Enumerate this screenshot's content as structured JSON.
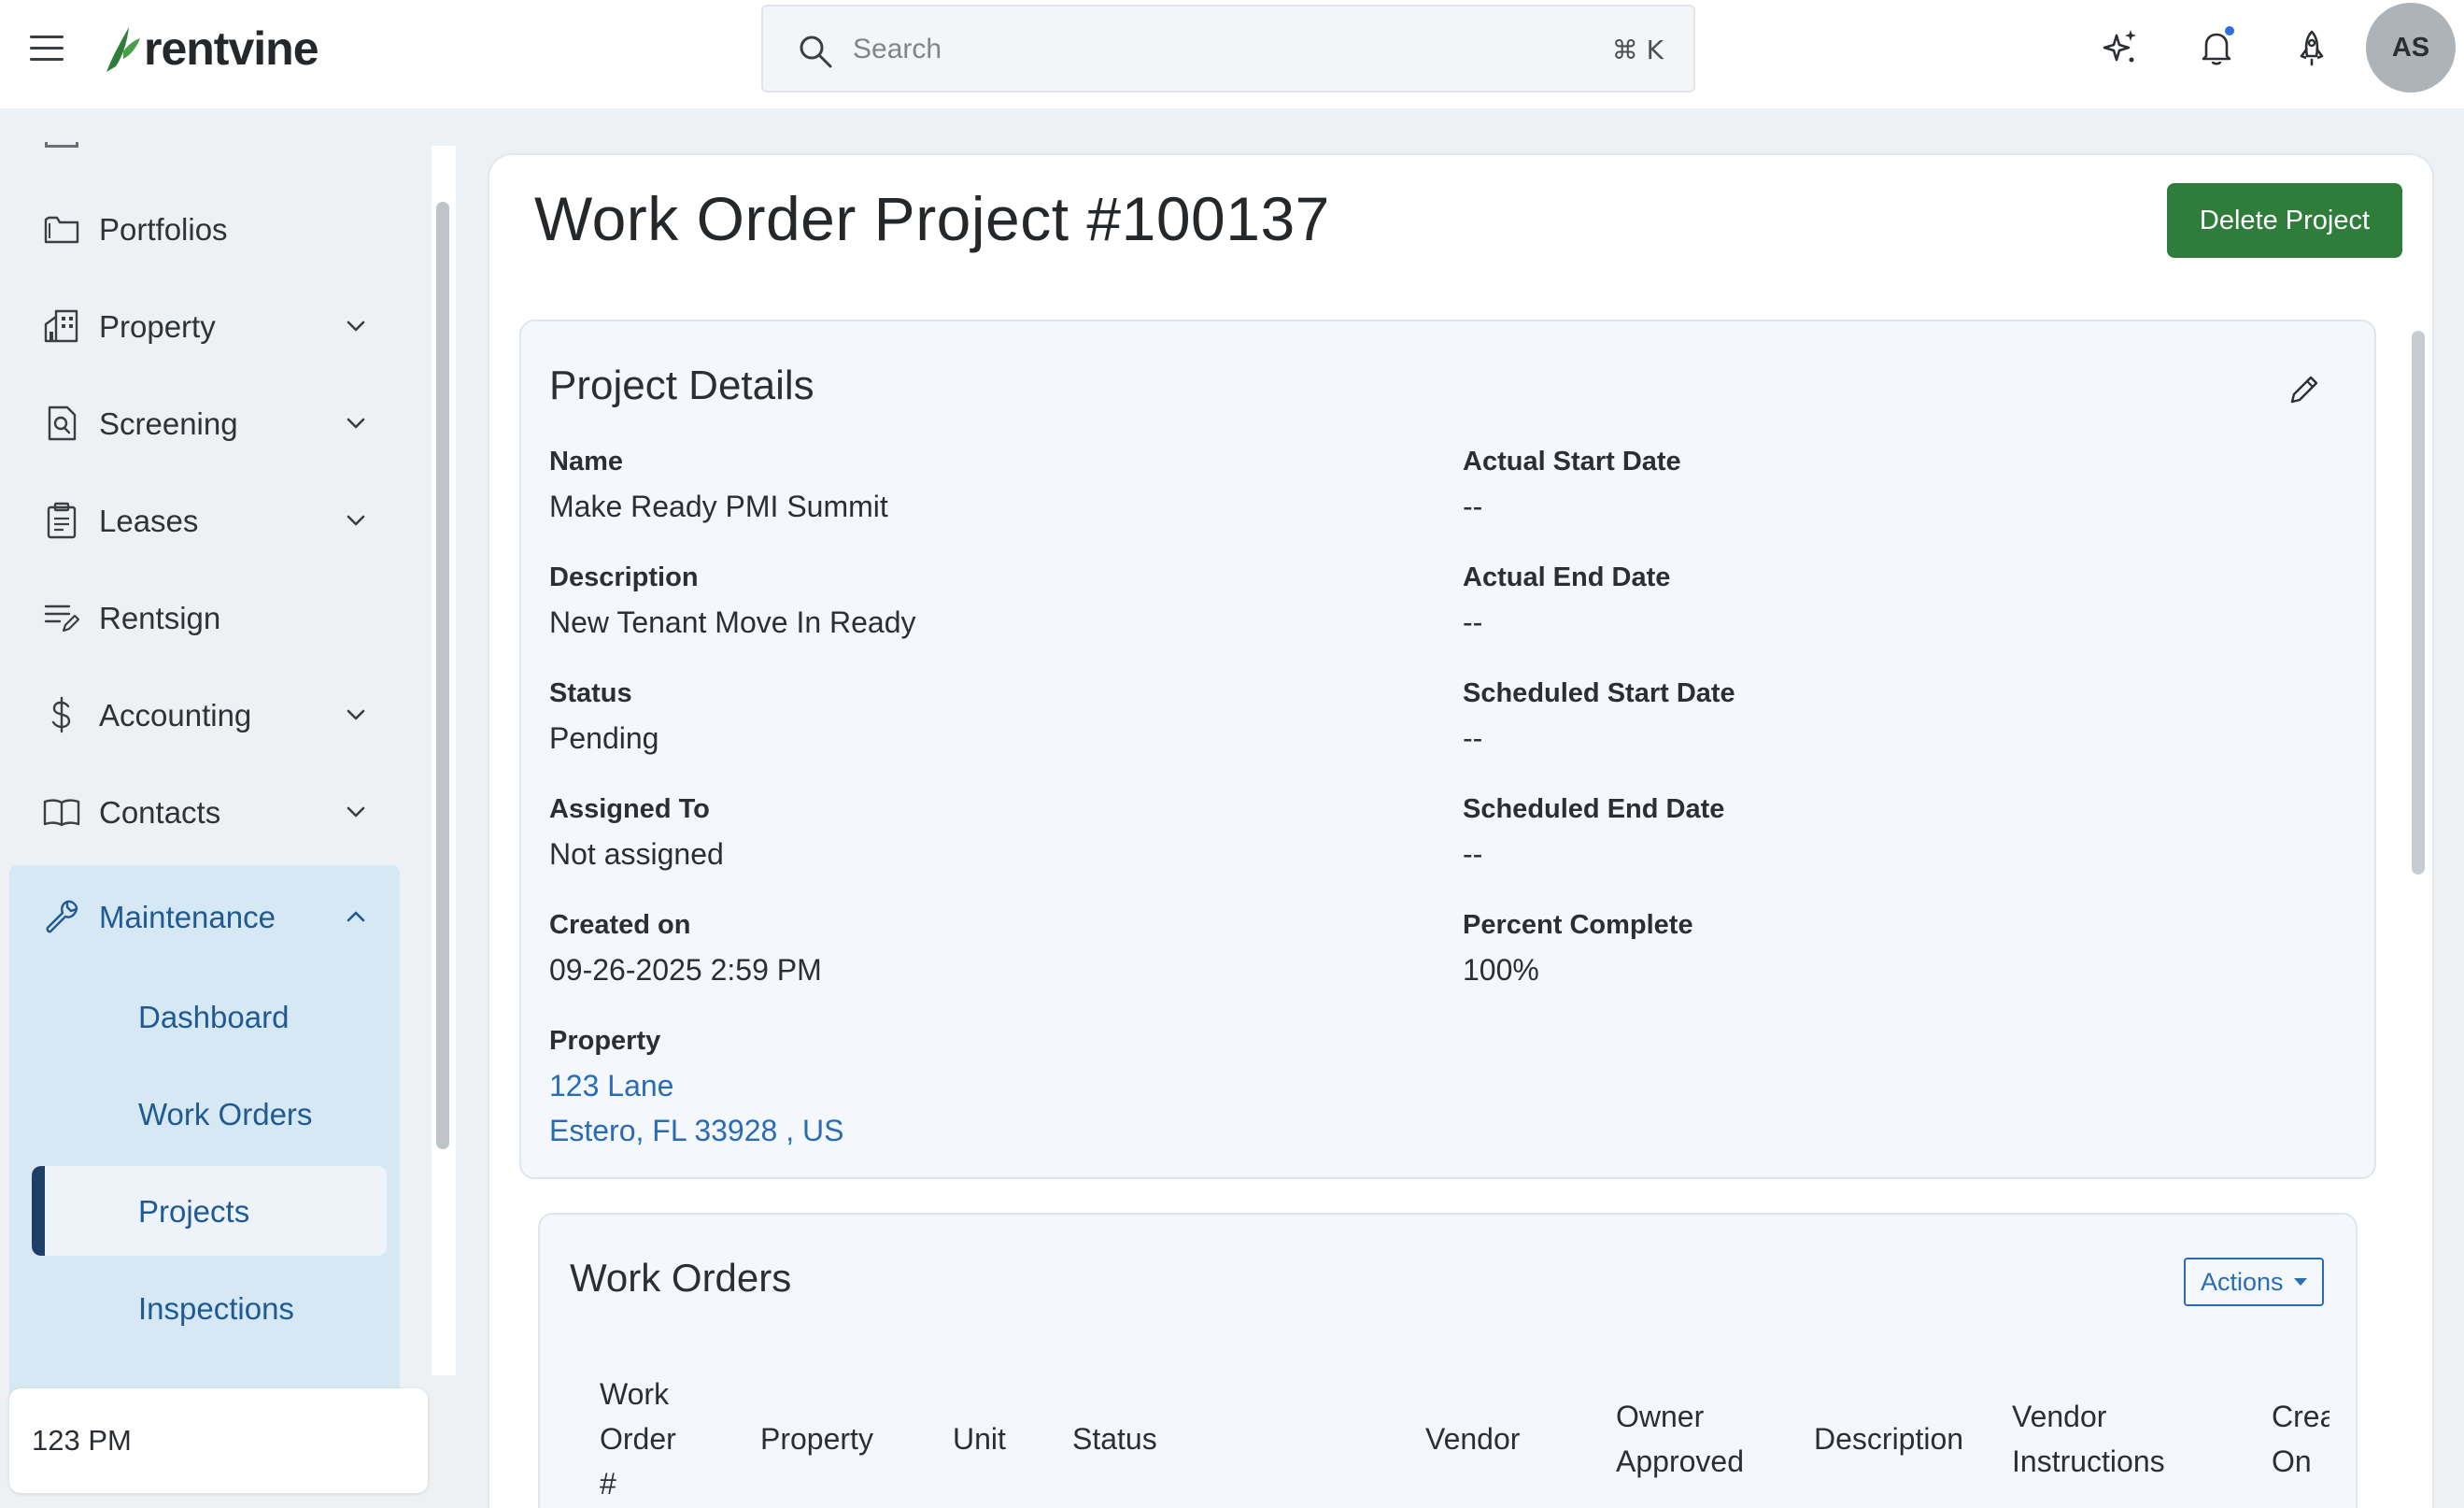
{
  "app": {
    "brand": "rentvine"
  },
  "search": {
    "placeholder": "Search",
    "shortcut": "⌘ K"
  },
  "user": {
    "initials": "AS"
  },
  "sidebar": {
    "items": [
      {
        "label": "Portfolios"
      },
      {
        "label": "Property"
      },
      {
        "label": "Screening"
      },
      {
        "label": "Leases"
      },
      {
        "label": "Rentsign"
      },
      {
        "label": "Accounting"
      },
      {
        "label": "Contacts"
      }
    ],
    "maintenance": {
      "label": "Maintenance",
      "subitems": [
        {
          "label": "Dashboard"
        },
        {
          "label": "Work Orders"
        },
        {
          "label": "Projects"
        },
        {
          "label": "Inspections"
        }
      ]
    },
    "footer_text": "123 PM"
  },
  "page": {
    "title": "Work Order Project #100137",
    "delete_label": "Delete Project"
  },
  "details": {
    "title": "Project Details",
    "fields": {
      "name_label": "Name",
      "name_value": "Make Ready PMI Summit",
      "description_label": "Description",
      "description_value": "New Tenant Move In Ready",
      "status_label": "Status",
      "status_value": "Pending",
      "assigned_label": "Assigned To",
      "assigned_value": "Not assigned",
      "created_label": "Created on",
      "created_value": "09-26-2025 2:59 PM",
      "property_label": "Property",
      "property_line1": "123 Lane",
      "property_line2": "Estero, FL 33928 , US",
      "actual_start_label": "Actual Start Date",
      "actual_start_value": "--",
      "actual_end_label": "Actual End Date",
      "actual_end_value": "--",
      "sched_start_label": "Scheduled Start Date",
      "sched_start_value": "--",
      "sched_end_label": "Scheduled End Date",
      "sched_end_value": "--",
      "percent_label": "Percent Complete",
      "percent_value": "100%"
    }
  },
  "work_orders": {
    "title": "Work Orders",
    "actions_label": "Actions",
    "columns": {
      "work_order_1": "Work",
      "work_order_2": "Order",
      "work_order_3": "#",
      "property": "Property",
      "unit": "Unit",
      "status": "Status",
      "vendor": "Vendor",
      "owner_1": "Owner",
      "owner_2": "Approved",
      "description": "Description",
      "vendor_instr_1": "Vendor",
      "vendor_instr_2": "Instructions",
      "created_1": "Created",
      "created_2": "On"
    }
  },
  "colors": {
    "brand_green": "#2f7d3a",
    "link_blue": "#2a6bb8",
    "nav_active_bg": "#d7e8f5",
    "nav_active_bar": "#1d3f66",
    "notification_dot": "#2f6ee0"
  },
  "icons": {
    "menu": "hamburger-icon",
    "search": "search-icon",
    "ai": "sparkle-icon",
    "notifications": "bell-icon",
    "launch": "rocket-icon",
    "edit": "pencil-icon"
  }
}
